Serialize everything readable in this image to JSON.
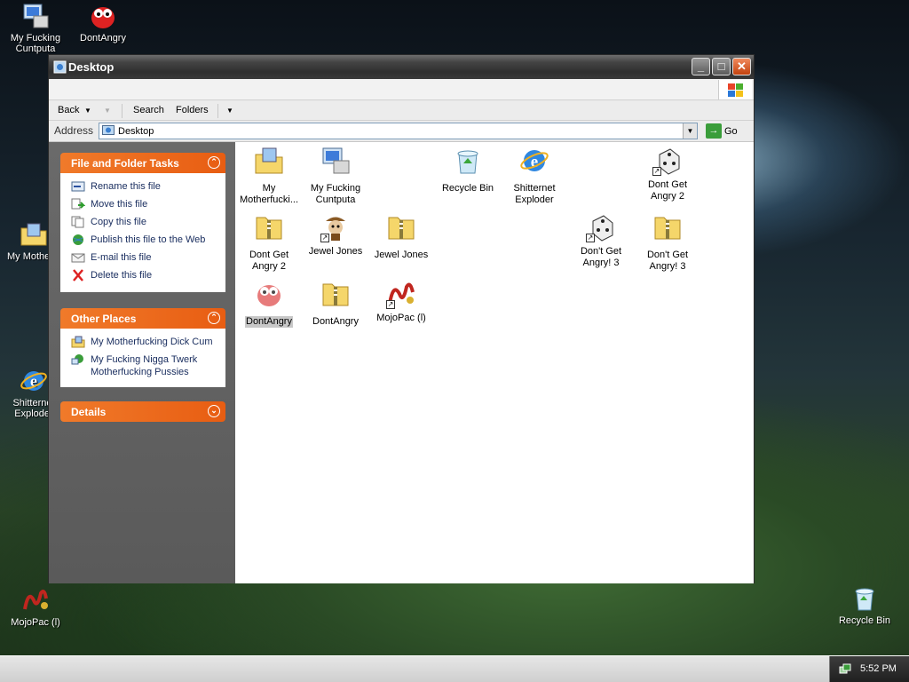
{
  "desktop": {
    "icons": [
      {
        "label": "My Fucking Cuntputa",
        "icon": "computer-icon"
      },
      {
        "label": "DontAngry",
        "icon": "red-creature-icon"
      },
      {
        "label": "My Motherfucking Dick Cum",
        "icon": "documents-folder-icon"
      },
      {
        "label": "Shitternet Exploder",
        "icon": "internet-explorer-icon"
      },
      {
        "label": "MojoPac (l)",
        "icon": "mojopac-icon"
      },
      {
        "label": "Recycle Bin",
        "icon": "recycle-bin-icon"
      }
    ]
  },
  "window": {
    "title": "Desktop",
    "toolbar": {
      "back": "Back",
      "search": "Search",
      "folders": "Folders"
    },
    "address": {
      "label": "Address",
      "value": "Desktop",
      "go": "Go"
    }
  },
  "leftpane": {
    "tasks": {
      "title": "File and Folder Tasks",
      "items": [
        {
          "label": "Rename this file",
          "icon": "rename-icon"
        },
        {
          "label": "Move this file",
          "icon": "move-icon"
        },
        {
          "label": "Copy this file",
          "icon": "copy-icon"
        },
        {
          "label": "Publish this file to the Web",
          "icon": "globe-icon"
        },
        {
          "label": "E-mail this file",
          "icon": "email-icon"
        },
        {
          "label": "Delete this file",
          "icon": "delete-icon"
        }
      ]
    },
    "places": {
      "title": "Other Places",
      "items": [
        {
          "label": "My Motherfucking Dick Cum",
          "icon": "documents-folder-icon"
        },
        {
          "label": "My Fucking Nigga Twerk Motherfucking Pussies",
          "icon": "network-icon"
        }
      ]
    },
    "details": {
      "title": "Details"
    }
  },
  "files": [
    {
      "label": "My Motherfucki...",
      "icon": "documents-folder-icon",
      "selected": false
    },
    {
      "label": "My Fucking Cuntputa",
      "icon": "computer-icon",
      "selected": false
    },
    {
      "label": "Recycle Bin",
      "icon": "recycle-bin-icon",
      "selected": false
    },
    {
      "label": "Shitternet Exploder",
      "icon": "internet-explorer-icon",
      "selected": false
    },
    {
      "label": "Dont Get Angry 2",
      "icon": "game-dice-icon",
      "selected": false
    },
    {
      "label": "Dont Get Angry 2",
      "icon": "zip-folder-icon",
      "selected": false
    },
    {
      "label": "Jewel Jones",
      "icon": "game-character-icon",
      "selected": false
    },
    {
      "label": "Jewel Jones",
      "icon": "zip-folder-icon",
      "selected": false
    },
    {
      "label": "Don't Get Angry! 3",
      "icon": "game-dice-icon",
      "selected": false
    },
    {
      "label": "Don't Get Angry! 3",
      "icon": "zip-folder-icon",
      "selected": false
    },
    {
      "label": "DontAngry",
      "icon": "red-creature-icon",
      "selected": true
    },
    {
      "label": "DontAngry",
      "icon": "zip-folder-icon",
      "selected": false
    },
    {
      "label": "MojoPac (l)",
      "icon": "mojopac-icon",
      "selected": false
    }
  ],
  "taskbar": {
    "clock": "5:52 PM"
  }
}
